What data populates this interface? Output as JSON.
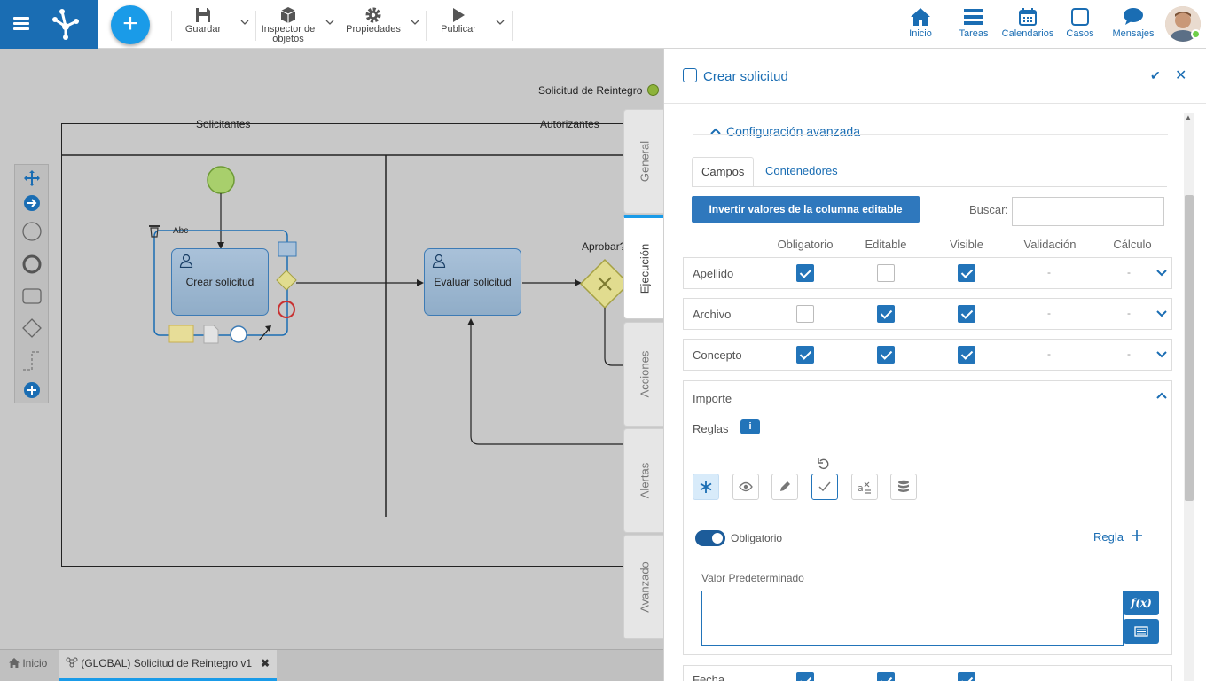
{
  "toolbar": {
    "save": "Guardar",
    "inspector_line1": "Inspector de",
    "inspector_line2": "objetos",
    "properties": "Propiedades",
    "publish": "Publicar"
  },
  "nav": {
    "home": "Inicio",
    "tasks": "Tareas",
    "calendars": "Calendarios",
    "cases": "Casos",
    "messages": "Mensajes"
  },
  "diagram": {
    "pool_title": "Solicitud de Reintegro",
    "lanes": [
      "Solicitantes",
      "Autorizantes"
    ],
    "task1": "Crear solicitud",
    "task2": "Evaluar solicitud",
    "gateway_label": "Aprobar?",
    "label_tool": "Abc"
  },
  "side_tabs": [
    "General",
    "Ejecución",
    "Acciones",
    "Alertas",
    "Avanzado"
  ],
  "panel": {
    "title": "Crear solicitud",
    "section": "Configuración avanzada",
    "tabs": [
      "Campos",
      "Contenedores"
    ],
    "invert_button": "Invertir valores de la columna editable",
    "search_label": "Buscar:",
    "search_value": "",
    "columns": [
      "Obligatorio",
      "Editable",
      "Visible",
      "Validación",
      "Cálculo"
    ],
    "rows": [
      {
        "name": "Apellido",
        "required": true,
        "editable": false,
        "visible": true,
        "validation": "-",
        "calc": "-"
      },
      {
        "name": "Archivo",
        "required": false,
        "editable": true,
        "visible": true,
        "validation": "-",
        "calc": "-"
      },
      {
        "name": "Concepto",
        "required": true,
        "editable": true,
        "visible": true,
        "validation": "-",
        "calc": "-"
      }
    ],
    "expanded_row": {
      "name": "Importe",
      "rules_label": "Reglas",
      "toggle_label": "Obligatorio",
      "add_rule": "Regla",
      "default_value_label": "Valor Predeterminado",
      "default_value": ""
    },
    "next_row": "Fecha"
  },
  "bottom_tabs": {
    "home": "Inicio",
    "diagram": "(GLOBAL) Solicitud de Reintegro v1"
  },
  "colors": {
    "brand": "#1a6db3",
    "accent": "#1a9be8",
    "checkbox": "#2274b9"
  }
}
